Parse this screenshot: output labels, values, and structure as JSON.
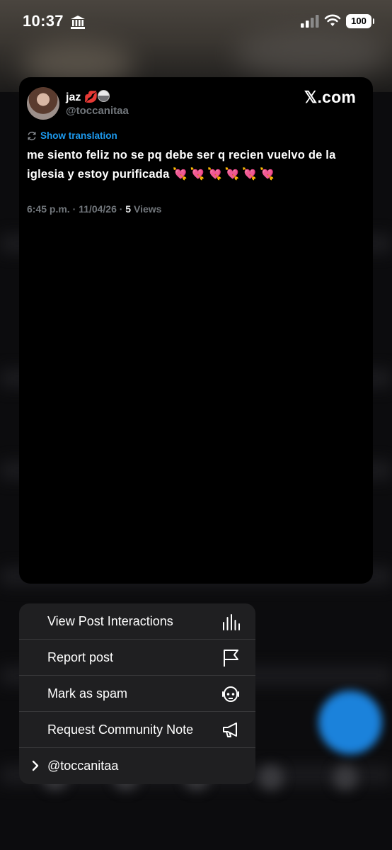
{
  "status_bar": {
    "time": "10:37",
    "battery": "100"
  },
  "post": {
    "display_name": "jaz 💋",
    "handle": "@toccanitaa",
    "site_logo": "𝕏.com",
    "translation_link": "Show translation",
    "text": "me siento feliz no se pq debe ser q recien vuelvo de la iglesia y estoy purificada",
    "emojis": "💘💘💘💘💘💘",
    "timestamp": "6:45 p.m. · 11/04/26 · ",
    "views_count": "5",
    "views_label": " Views"
  },
  "menu": {
    "items": [
      {
        "label": "View Post Interactions",
        "icon": "bar-chart-icon"
      },
      {
        "label": "Report post",
        "icon": "flag-icon"
      },
      {
        "label": "Mark as spam",
        "icon": "robot-icon"
      },
      {
        "label": "Request Community Note",
        "icon": "megaphone-icon"
      },
      {
        "label": "@toccanitaa",
        "icon": "chevron-right-icon"
      }
    ]
  },
  "colors": {
    "accent": "#1d9bf0",
    "muted": "#71767b",
    "card": "#000000",
    "menu": "#1f1f21"
  }
}
